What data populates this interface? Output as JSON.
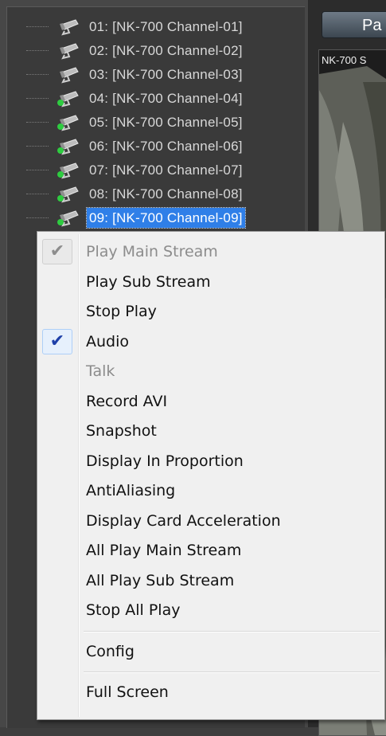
{
  "channel_tree": {
    "items": [
      {
        "label": "01: [NK-700 Channel-01]",
        "status": "idle"
      },
      {
        "label": "02: [NK-700 Channel-02]",
        "status": "idle"
      },
      {
        "label": "03: [NK-700 Channel-03]",
        "status": "idle"
      },
      {
        "label": "04: [NK-700 Channel-04]",
        "status": "playing"
      },
      {
        "label": "05: [NK-700 Channel-05]",
        "status": "playing"
      },
      {
        "label": "06: [NK-700 Channel-06]",
        "status": "playing"
      },
      {
        "label": "07: [NK-700 Channel-07]",
        "status": "playing"
      },
      {
        "label": "08: [NK-700 Channel-08]",
        "status": "playing"
      },
      {
        "label": "09: [NK-700 Channel-09]",
        "status": "playing",
        "selected": true
      }
    ]
  },
  "toolbar": {
    "pause_label": "Pa"
  },
  "video": {
    "title": "NK-700 S"
  },
  "context_menu": {
    "items": [
      {
        "label": "Play Main Stream",
        "checked": true,
        "enabled": false
      },
      {
        "label": "Play Sub Stream",
        "checked": false,
        "enabled": true
      },
      {
        "label": "Stop Play",
        "checked": false,
        "enabled": true
      },
      {
        "label": "Audio",
        "checked": true,
        "enabled": true
      },
      {
        "label": "Talk",
        "checked": false,
        "enabled": false
      },
      {
        "label": "Record AVI",
        "checked": false,
        "enabled": true
      },
      {
        "label": "Snapshot",
        "checked": false,
        "enabled": true
      },
      {
        "label": "Display In Proportion",
        "checked": false,
        "enabled": true
      },
      {
        "label": "AntiAliasing",
        "checked": false,
        "enabled": true
      },
      {
        "label": "Display Card Acceleration",
        "checked": false,
        "enabled": true
      },
      {
        "label": "All Play Main Stream",
        "checked": false,
        "enabled": true
      },
      {
        "label": "All Play Sub Stream",
        "checked": false,
        "enabled": true
      },
      {
        "label": "Stop All Play",
        "checked": false,
        "enabled": true
      },
      {
        "separator": true
      },
      {
        "label": "Config",
        "checked": false,
        "enabled": true
      },
      {
        "separator": true
      },
      {
        "label": "Full Screen",
        "checked": false,
        "enabled": true
      }
    ]
  },
  "colors": {
    "selection": "#2f7fe8",
    "status_playing": "#2ecc40",
    "check_active": "#1e3fa8",
    "disabled_text": "#8c8c8c"
  },
  "icons": {
    "camera": "camera-icon",
    "check": "checkmark-icon"
  }
}
